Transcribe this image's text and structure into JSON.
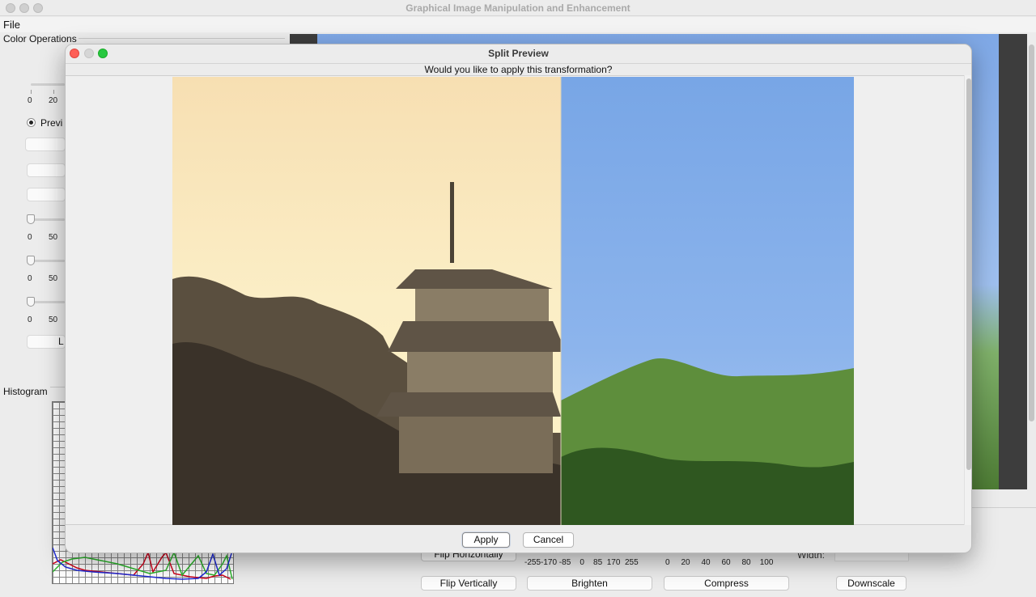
{
  "app": {
    "window_title": "Graphical Image Manipulation and Enhancement",
    "menu": {
      "file_label": "File"
    }
  },
  "left_panel": {
    "color_operations_title": "Color Operations",
    "slider1_ticks": [
      "0",
      "20"
    ],
    "preview_radio_label": "Previ",
    "slider2_ticks": [
      "0",
      "50"
    ],
    "slider3_ticks": [
      "0",
      "50"
    ],
    "slider4_ticks": [
      "0",
      "50"
    ],
    "partial_button_label": "L",
    "histogram_title": "Histogram"
  },
  "bottom_panel": {
    "flip_horizontally_label": "Flip Horizontally",
    "flip_vertically_label": "Flip Vertically",
    "brighten_label": "Brighten",
    "compress_label": "Compress",
    "downscale_label": "Downscale",
    "brighten_scale": "-255-170 -85    0    85  170  255",
    "compress_scale": "0     20     40     60     80    100",
    "width_label": "Width:"
  },
  "dialog": {
    "title": "Split Preview",
    "prompt": "Would you like to apply this transformation?",
    "apply_label": "Apply",
    "cancel_label": "Cancel",
    "split_fraction": 0.57,
    "left_half_effect": "sepia",
    "right_half_effect": "original"
  },
  "histogram_colors": {
    "red": "#d0021b",
    "green": "#2bb52b",
    "blue": "#1f2bd6"
  },
  "traffic_lights": {
    "close": "#fe5f57",
    "minimize": "#d6d6d6",
    "maximize": "#28c840"
  }
}
